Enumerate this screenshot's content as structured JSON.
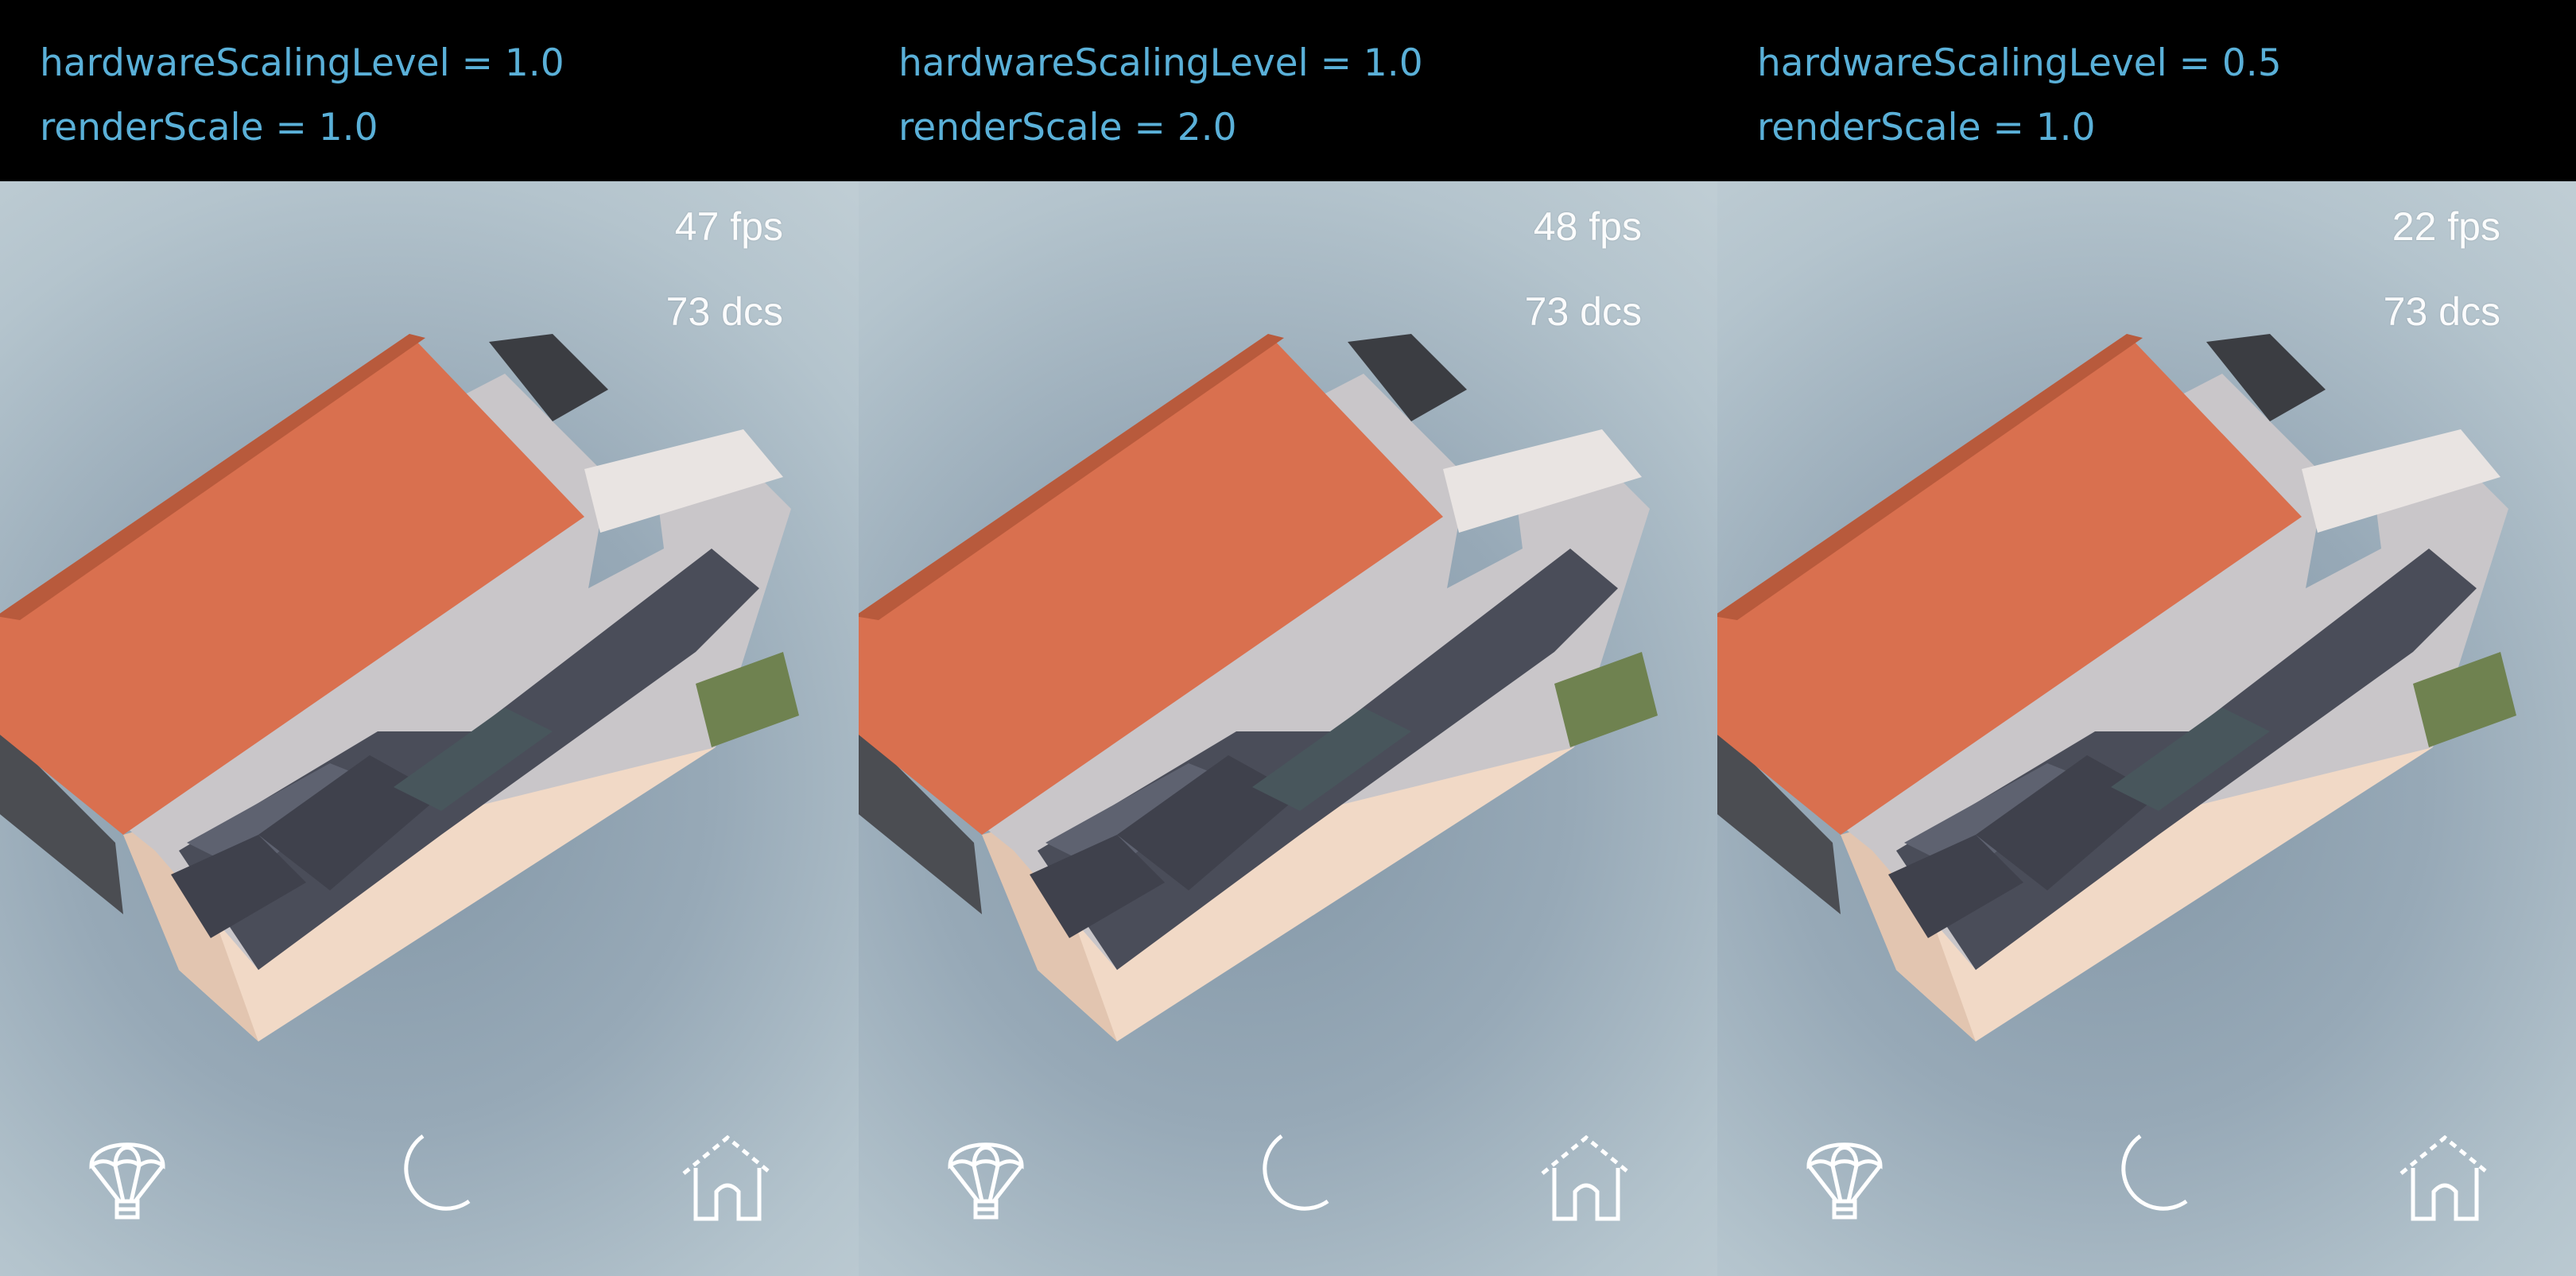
{
  "panels": [
    {
      "hardware_label": "hardwareScalingLevel = 1.0",
      "render_label": "renderScale = 1.0",
      "fps": "47 fps",
      "dcs": "73 dcs"
    },
    {
      "hardware_label": "hardwareScalingLevel = 1.0",
      "render_label": "renderScale = 2.0",
      "fps": "48 fps",
      "dcs": "73 dcs"
    },
    {
      "hardware_label": "hardwareScalingLevel = 0.5",
      "render_label": "renderScale = 1.0",
      "fps": "22 fps",
      "dcs": "73 dcs"
    }
  ],
  "toolbar_icons": [
    "parachute-icon",
    "moon-icon",
    "home-icon"
  ],
  "colors": {
    "header_text": "#5ab0d8",
    "header_bg": "#000000",
    "roof": "#d9704f",
    "wall": "#f1d9c6",
    "paving": "#4a4d59"
  }
}
